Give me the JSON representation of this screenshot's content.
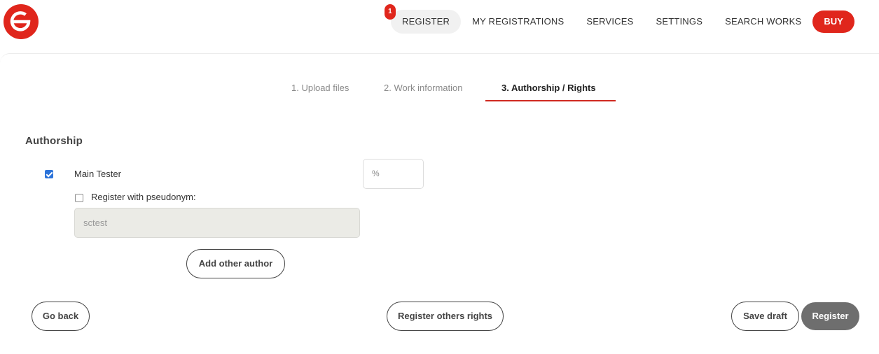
{
  "header": {
    "nav": [
      {
        "label": "REGISTER",
        "badge": "1",
        "active": true
      },
      {
        "label": "MY REGISTRATIONS"
      },
      {
        "label": "SERVICES"
      },
      {
        "label": "SETTINGS"
      },
      {
        "label": "SEARCH WORKS"
      }
    ],
    "buy_label": "BUY"
  },
  "steps": [
    {
      "label": "1. Upload files"
    },
    {
      "label": "2. Work information"
    },
    {
      "label": "3. Authorship / Rights",
      "active": true
    }
  ],
  "authorship": {
    "title": "Authorship",
    "author_name": "Main Tester",
    "author_checked": true,
    "percent_placeholder": "%",
    "pseudonym_label": "Register with pseudonym:",
    "pseudonym_checked": false,
    "pseudonym_value": "sctest",
    "add_author_label": "Add other author"
  },
  "footer": {
    "go_back_label": "Go back",
    "register_others_label": "Register others rights",
    "save_draft_label": "Save draft",
    "register_label": "Register"
  },
  "colors": {
    "brand_red": "#e0261c",
    "checkbox_blue": "#2c73d9",
    "register_button": "#6e6e6e"
  }
}
